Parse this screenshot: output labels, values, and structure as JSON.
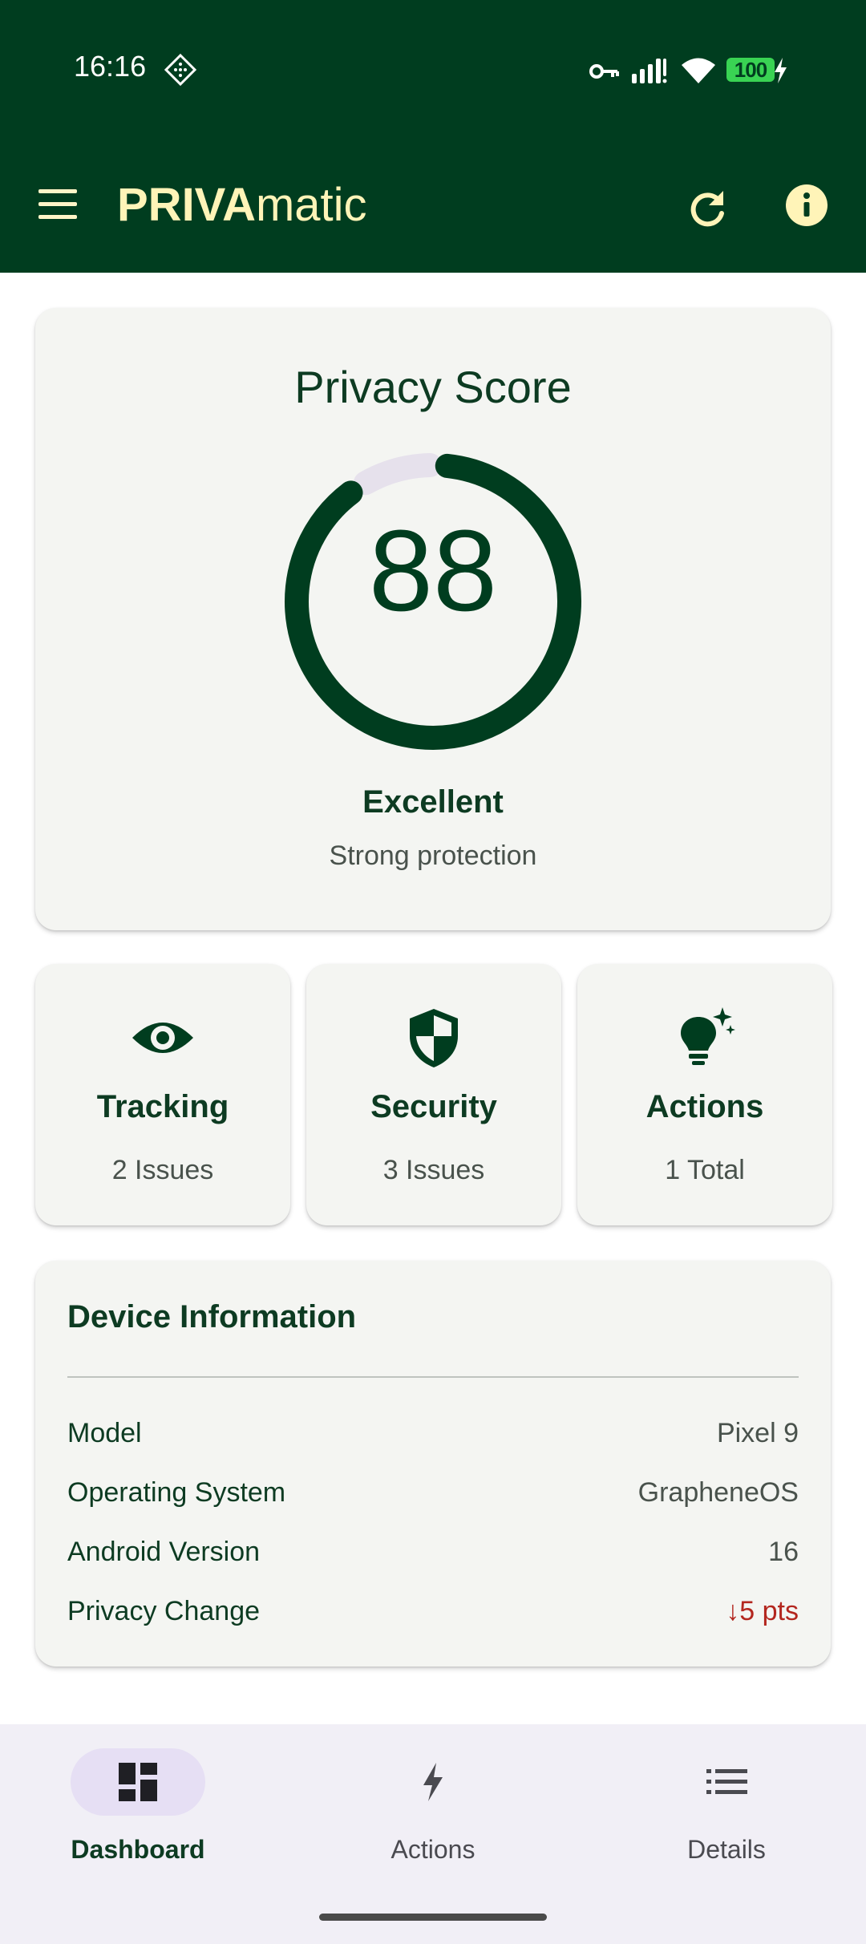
{
  "status_bar": {
    "time": "16:16",
    "battery": "100",
    "icons": [
      "nfc-diamond-icon",
      "vpn-key-icon",
      "signal-icon",
      "wifi-icon",
      "battery-charging-icon"
    ]
  },
  "app_bar": {
    "title_bold": "PRIVA",
    "title_rest": "matic",
    "icons": [
      "menu-icon",
      "refresh-icon",
      "info-icon"
    ]
  },
  "score": {
    "title": "Privacy Score",
    "value": "88",
    "percent": 88,
    "label": "Excellent",
    "sub": "Strong protection"
  },
  "stats": [
    {
      "icon": "eye-icon",
      "title": "Tracking",
      "sub": "2 Issues"
    },
    {
      "icon": "shield-icon",
      "title": "Security",
      "sub": "3 Issues"
    },
    {
      "icon": "lightbulb-sparkle-icon",
      "title": "Actions",
      "sub": "1 Total"
    }
  ],
  "device": {
    "title": "Device Information",
    "rows": [
      {
        "key": "Model",
        "value": "Pixel 9"
      },
      {
        "key": "Operating System",
        "value": "GrapheneOS"
      },
      {
        "key": "Android Version",
        "value": "16"
      },
      {
        "key": "Privacy Change",
        "value": "↓5 pts"
      }
    ]
  },
  "nav": [
    {
      "icon": "dashboard-icon",
      "label": "Dashboard"
    },
    {
      "icon": "bolt-icon",
      "label": "Actions"
    },
    {
      "icon": "list-icon",
      "label": "Details"
    }
  ],
  "colors": {
    "primary": "#003d1f",
    "accent_text": "#fff4b8",
    "negative": "#b3261e",
    "gauge_track": "#e6e1ec"
  }
}
